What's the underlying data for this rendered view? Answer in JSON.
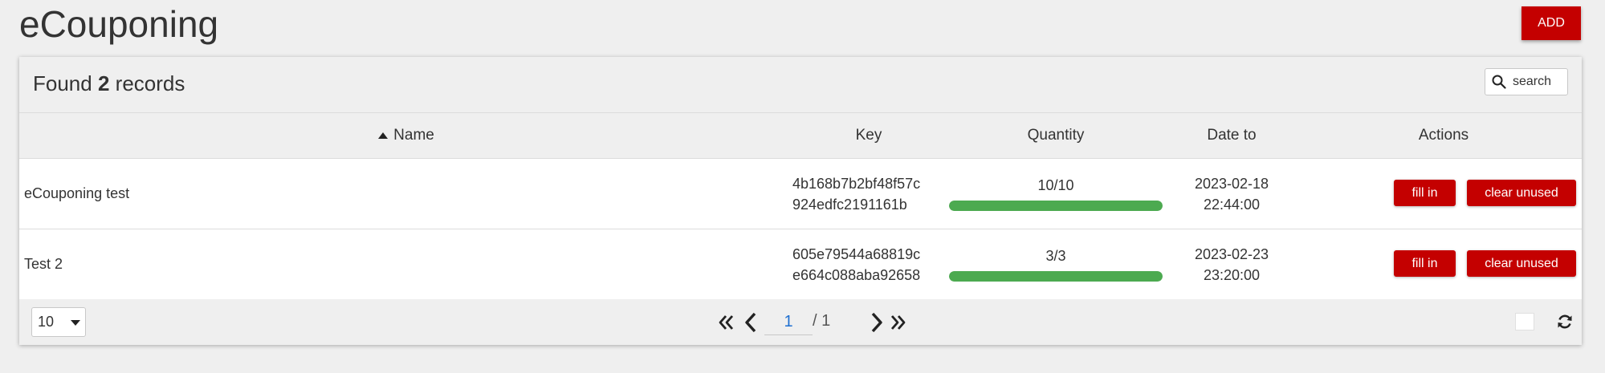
{
  "page": {
    "title": "eCouponing"
  },
  "toolbar": {
    "add_label": "ADD"
  },
  "header": {
    "found_prefix": "Found",
    "found_count": "2",
    "found_suffix": "records"
  },
  "search": {
    "placeholder": "search"
  },
  "columns": {
    "name": "Name",
    "key": "Key",
    "quantity": "Quantity",
    "date_to": "Date to",
    "actions": "Actions"
  },
  "sort": {
    "column": "Name",
    "direction": "ascending"
  },
  "rows": [
    {
      "name": "eCouponing test",
      "key_line1": "4b168b7b2bf48f57c",
      "key_line2": "924edfc2191161b",
      "quantity": "10/10",
      "quantity_fraction": 1.0,
      "date": "2023-02-18",
      "time": "22:44:00",
      "fill_label": "fill in",
      "clear_label": "clear unused"
    },
    {
      "name": "Test 2",
      "key_line1": "605e79544a68819c",
      "key_line2": "e664c088aba92658",
      "quantity": "3/3",
      "quantity_fraction": 1.0,
      "date": "2023-02-23",
      "time": "23:20:00",
      "fill_label": "fill in",
      "clear_label": "clear unused"
    }
  ],
  "pagination": {
    "page_size": "10",
    "current_page": "1",
    "total_label": "/ 1"
  },
  "colors": {
    "accent": "#c40000",
    "progress": "#4caa50",
    "page_link": "#1e6fd0"
  },
  "icons": {
    "search": "search-icon",
    "sort": "sort-asc-icon",
    "first": "double-chevron-left-icon",
    "prev": "chevron-left-icon",
    "next": "chevron-right-icon",
    "last": "double-chevron-right-icon",
    "refresh": "refresh-icon",
    "dropdown": "caret-down-icon"
  }
}
